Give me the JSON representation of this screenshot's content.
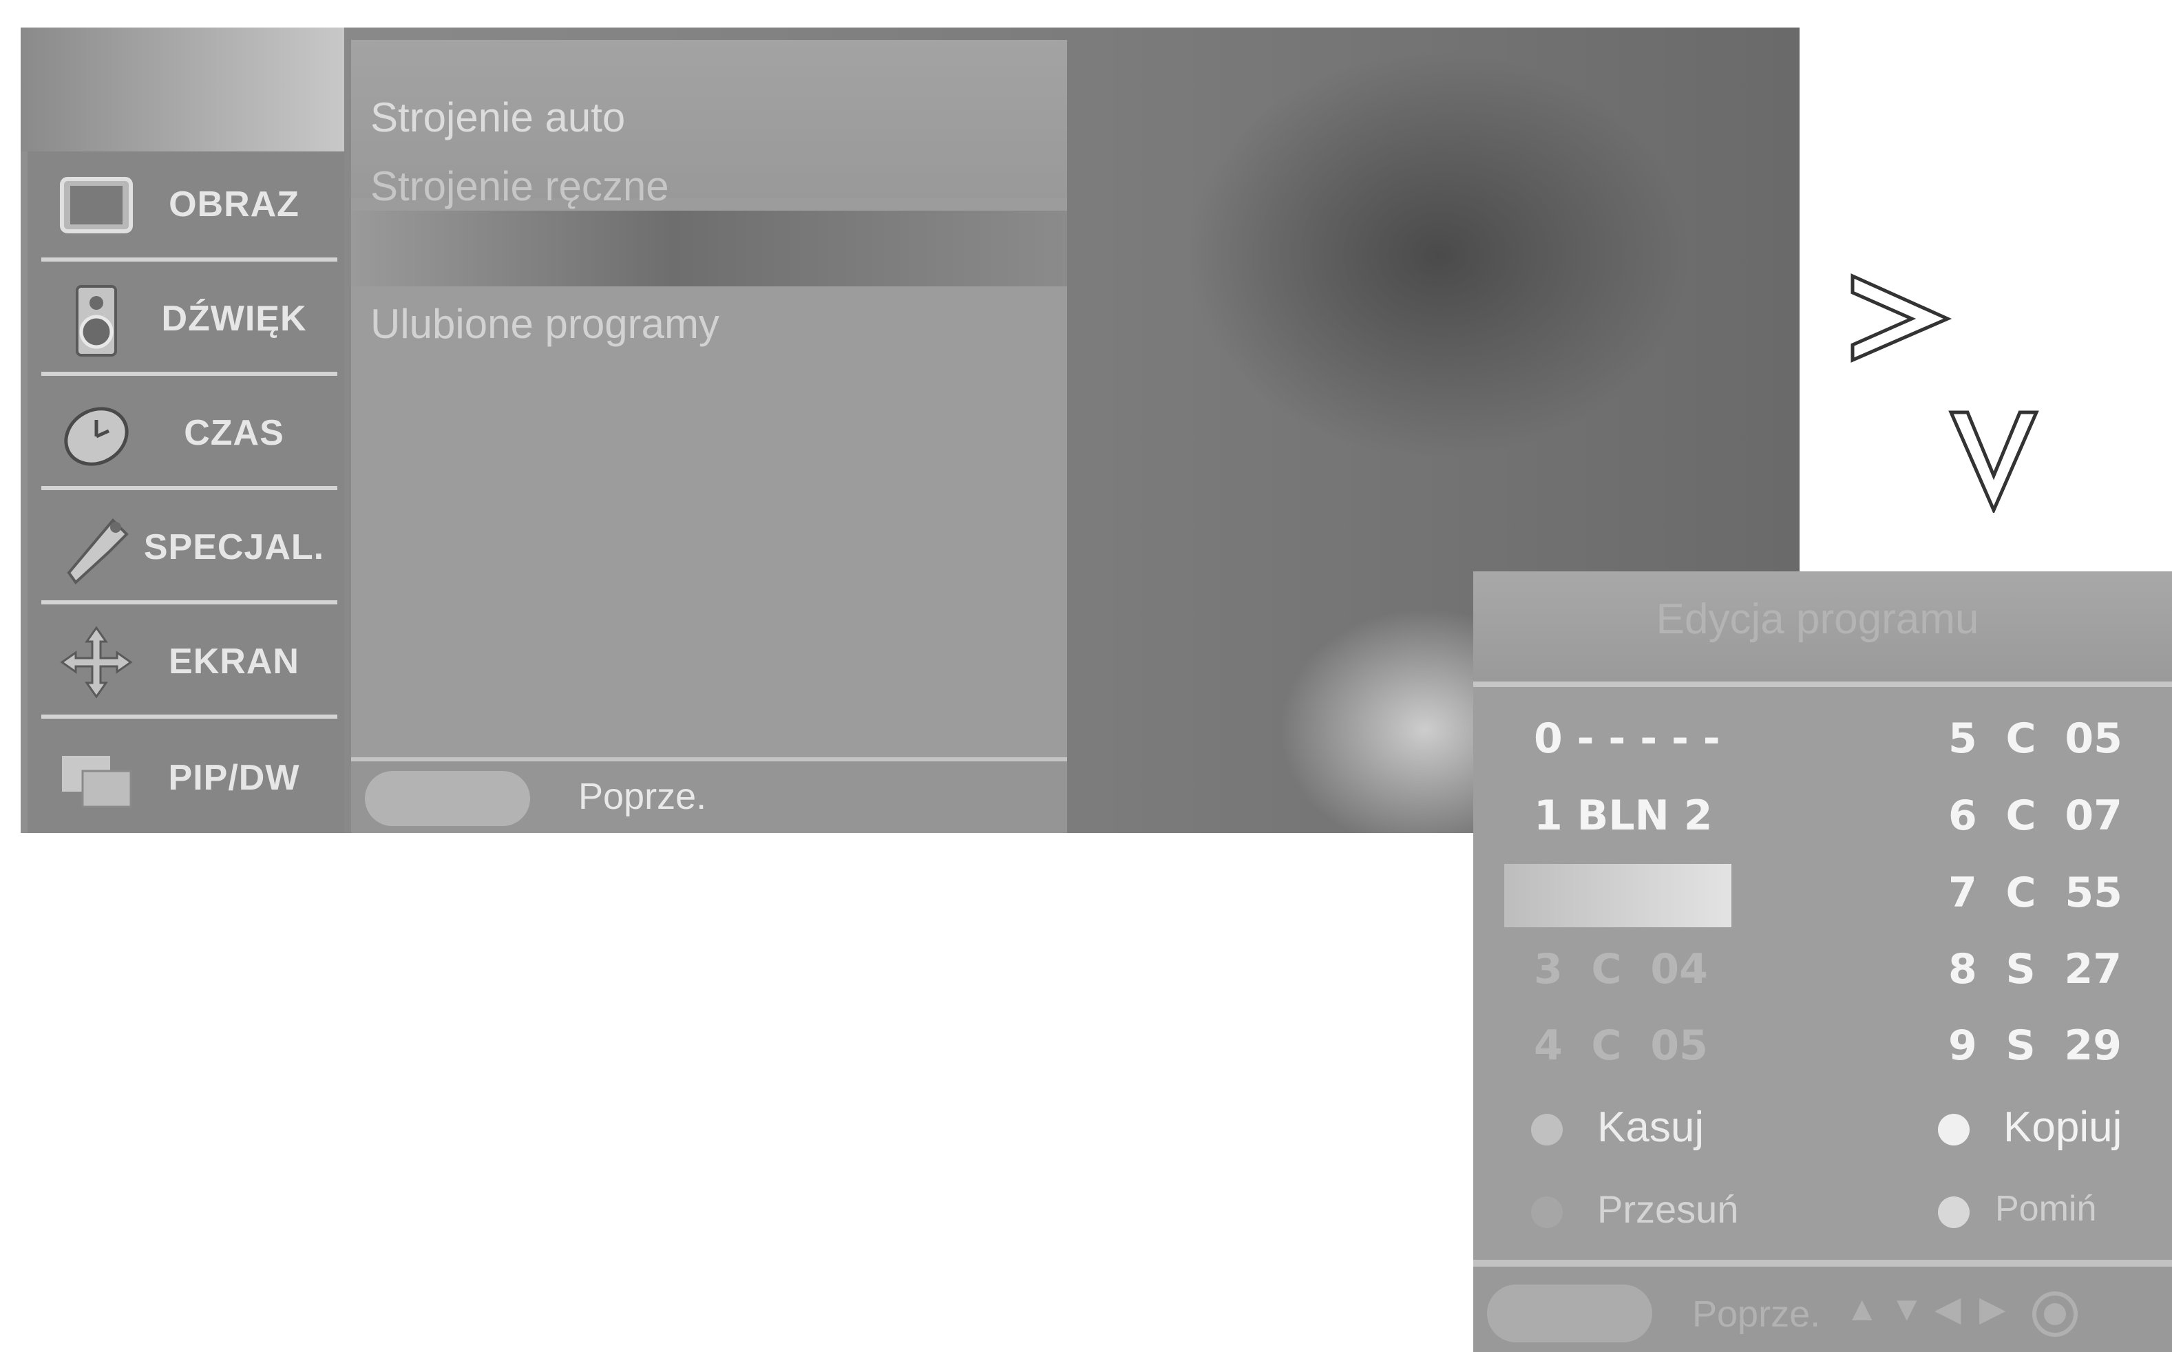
{
  "main_menu": {
    "sidebar": [
      {
        "label": "OBRAZ",
        "icon": "tv-screen-icon"
      },
      {
        "label": "DŹWIĘK",
        "icon": "speaker-icon"
      },
      {
        "label": "CZAS",
        "icon": "clock-icon"
      },
      {
        "label": "SPECJAL.",
        "icon": "tag-icon"
      },
      {
        "label": "EKRAN",
        "icon": "move-arrows-icon"
      },
      {
        "label": "PIP/DW",
        "icon": "pip-windows-icon"
      }
    ],
    "submenu": {
      "items": [
        "Strojenie auto",
        "Strojenie ręczne",
        "",
        "Ulubione programy"
      ]
    },
    "footer": {
      "label": "Poprze."
    }
  },
  "arrows": {
    "right": "right-arrow-icon",
    "down": "down-arrow-icon"
  },
  "program_edit": {
    "title": "Edycja programu",
    "left_column": [
      {
        "text": "0 - - - - -",
        "dim": false
      },
      {
        "text": "1 BLN 2",
        "dim": false
      },
      {
        "text": "",
        "dim": false
      },
      {
        "text": "3  C  04",
        "dim": true
      },
      {
        "text": "4  C  05",
        "dim": true
      }
    ],
    "right_column": [
      {
        "text": "5  C  05"
      },
      {
        "text": "6  C  07"
      },
      {
        "text": "7  C  55"
      },
      {
        "text": "8  S  27"
      },
      {
        "text": "9  S  29"
      }
    ],
    "actions": [
      {
        "label": "Kasuj",
        "dot_color": "#c0c0c0"
      },
      {
        "label": "Kopiuj",
        "dot_color": "#f0f0f0"
      },
      {
        "label": "Przesuń",
        "dot_color": "#a6a6a6"
      },
      {
        "label": "Pomiń",
        "dot_color": "#d8d8d8"
      }
    ],
    "footer": {
      "label": "Poprze.",
      "nav_icons": [
        "up-arrow-icon",
        "down-arrow-icon",
        "left-arrow-icon",
        "right-arrow-icon",
        "ok-button-icon"
      ]
    }
  }
}
